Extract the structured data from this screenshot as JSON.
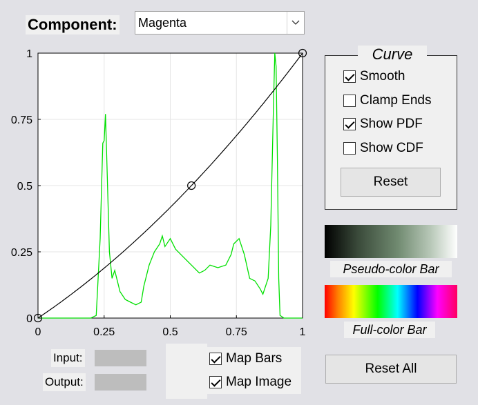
{
  "component": {
    "label": "Component:",
    "selected": "Magenta"
  },
  "curve_panel": {
    "title": "Curve",
    "checkboxes": [
      {
        "label": "Smooth",
        "checked": true
      },
      {
        "label": "Clamp Ends",
        "checked": false
      },
      {
        "label": "Show PDF",
        "checked": true
      },
      {
        "label": "Show CDF",
        "checked": false
      }
    ],
    "reset_label": "Reset"
  },
  "bars": {
    "pseudo_label": "Pseudo-color Bar",
    "full_label": "Full-color Bar"
  },
  "fields": {
    "input_label": "Input:",
    "output_label": "Output:"
  },
  "map": {
    "bars_label": "Map Bars",
    "bars_checked": true,
    "image_label": "Map Image",
    "image_checked": true
  },
  "reset_all_label": "Reset All",
  "colors": {
    "pdf": "#00e000",
    "curve": "#000000",
    "pseudo_start": "#000000",
    "pseudo_end": "#ffffff"
  },
  "chart_data": {
    "type": "line",
    "xlim": [
      0,
      1
    ],
    "ylim": [
      0,
      1
    ],
    "grid": true,
    "xticks": [
      "0",
      "0.25",
      "0.5",
      "0.75",
      "1"
    ],
    "yticks": [
      "0",
      "0.25",
      "0.5",
      "0.75",
      "1"
    ],
    "control_points": [
      [
        0,
        0
      ],
      [
        0.58,
        0.5
      ],
      [
        1,
        1
      ]
    ],
    "pdf": [
      [
        0,
        0
      ],
      [
        0.2,
        0
      ],
      [
        0.22,
        0.01
      ],
      [
        0.235,
        0.3
      ],
      [
        0.245,
        0.66
      ],
      [
        0.25,
        0.67
      ],
      [
        0.255,
        0.77
      ],
      [
        0.26,
        0.6
      ],
      [
        0.27,
        0.25
      ],
      [
        0.28,
        0.15
      ],
      [
        0.29,
        0.18
      ],
      [
        0.3,
        0.14
      ],
      [
        0.31,
        0.1
      ],
      [
        0.33,
        0.07
      ],
      [
        0.35,
        0.06
      ],
      [
        0.37,
        0.05
      ],
      [
        0.39,
        0.06
      ],
      [
        0.4,
        0.12
      ],
      [
        0.42,
        0.2
      ],
      [
        0.44,
        0.25
      ],
      [
        0.46,
        0.28
      ],
      [
        0.47,
        0.31
      ],
      [
        0.48,
        0.27
      ],
      [
        0.5,
        0.3
      ],
      [
        0.52,
        0.26
      ],
      [
        0.55,
        0.23
      ],
      [
        0.58,
        0.2
      ],
      [
        0.61,
        0.17
      ],
      [
        0.63,
        0.18
      ],
      [
        0.65,
        0.2
      ],
      [
        0.68,
        0.19
      ],
      [
        0.71,
        0.2
      ],
      [
        0.73,
        0.24
      ],
      [
        0.74,
        0.28
      ],
      [
        0.76,
        0.3
      ],
      [
        0.78,
        0.24
      ],
      [
        0.8,
        0.15
      ],
      [
        0.82,
        0.14
      ],
      [
        0.84,
        0.11
      ],
      [
        0.85,
        0.09
      ],
      [
        0.87,
        0.15
      ],
      [
        0.88,
        0.35
      ],
      [
        0.89,
        0.8
      ],
      [
        0.895,
        1.0
      ],
      [
        0.9,
        0.95
      ],
      [
        0.905,
        0.6
      ],
      [
        0.91,
        0.15
      ],
      [
        0.915,
        0.01
      ],
      [
        0.93,
        0
      ],
      [
        1,
        0
      ]
    ]
  }
}
